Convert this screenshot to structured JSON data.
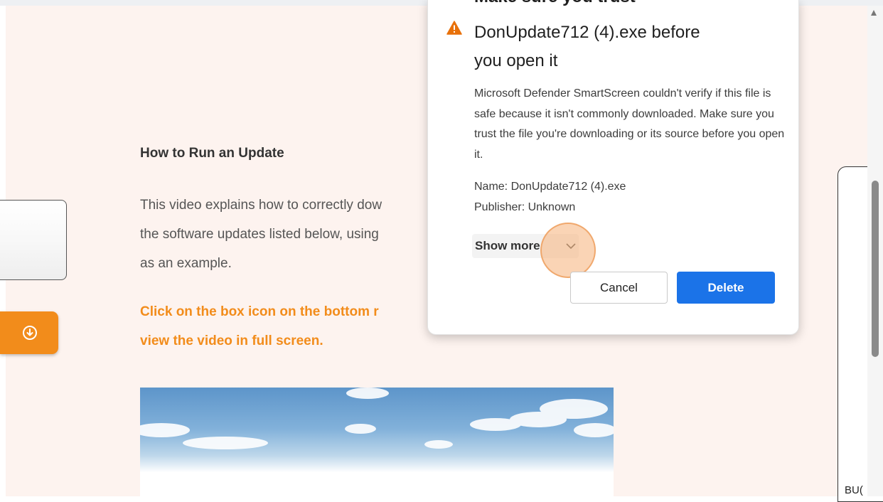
{
  "article": {
    "title": "How to Run an Update",
    "body": "This video explains how to correctly dow\nthe software updates listed below, using\nas an example.",
    "cta": "Click on the box icon on the bottom r\nview the video in full screen."
  },
  "side": {
    "right_label": "BU("
  },
  "dialog": {
    "title_cut": "Make sure you trust",
    "title": "DonUpdate712 (4).exe before\nyou open it",
    "body": "Microsoft Defender SmartScreen couldn't verify if this file is safe because it isn't commonly downloaded. Make sure you trust the file you're downloading or its source before you open it.",
    "name_line": "Name: DonUpdate712 (4).exe",
    "publisher_line": "Publisher: Unknown",
    "show_more": "Show more",
    "cancel": "Cancel",
    "delete": "Delete"
  },
  "colors": {
    "page_background": "#fdf3ef",
    "accent_orange": "#f28c1b",
    "delete_blue": "#1b73e8",
    "warning_orange": "#e8710a"
  },
  "icons": {
    "warning": "warning-triangle-icon",
    "show_more": "chevron-down-icon",
    "download": "circle-down-arrow-icon",
    "scroll_up": "scroll-up-arrow-icon"
  }
}
